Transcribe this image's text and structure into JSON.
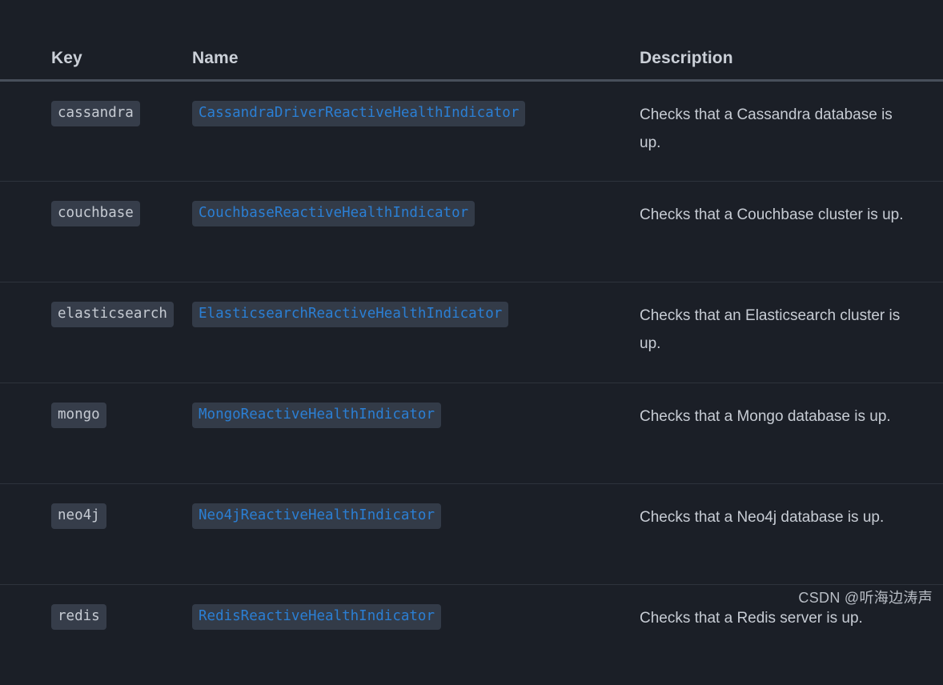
{
  "table": {
    "columns": [
      {
        "id": "key",
        "label": "Key"
      },
      {
        "id": "name",
        "label": "Name"
      },
      {
        "id": "description",
        "label": "Description"
      }
    ],
    "rows": [
      {
        "key": "cassandra",
        "name": "CassandraDriverReactiveHealthIndicator",
        "description": "Checks that a Cassandra database is up."
      },
      {
        "key": "couchbase",
        "name": "CouchbaseReactiveHealthIndicator",
        "description": "Checks that a Couchbase cluster is up."
      },
      {
        "key": "elasticsearch",
        "name": "ElasticsearchReactiveHealthIndicator",
        "description": "Checks that an Elasticsearch cluster is up."
      },
      {
        "key": "mongo",
        "name": "MongoReactiveHealthIndicator",
        "description": "Checks that a Mongo database is up."
      },
      {
        "key": "neo4j",
        "name": "Neo4jReactiveHealthIndicator",
        "description": "Checks that a Neo4j database is up."
      },
      {
        "key": "redis",
        "name": "RedisReactiveHealthIndicator",
        "description": "Checks that a Redis server is up."
      }
    ]
  },
  "watermark": {
    "text": "CSDN @听海边涛声"
  },
  "colors": {
    "page_background": "#1b1f27",
    "header_text": "#cbd0d8",
    "header_rule": "#484f5b",
    "row_rule": "#2e333c",
    "key_chip_background": "#363d4a",
    "key_chip_text": "#c6cbd3",
    "name_chip_background": "#333b48",
    "name_chip_text": "#2b7fd4",
    "description_text": "#c7ccd4",
    "watermark_text": "#b9bec6"
  }
}
